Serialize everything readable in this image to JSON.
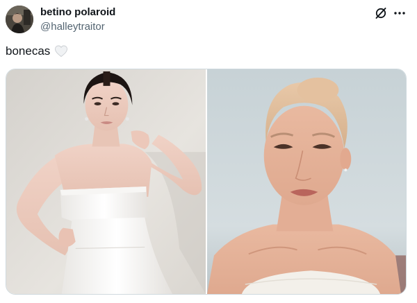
{
  "author": {
    "display_name": "betino polaroid",
    "handle": "@halleytraitor"
  },
  "header_icons": {
    "grok": "grok-icon",
    "more": "more-icon"
  },
  "tweet": {
    "text": "bonecas",
    "emoji": "white-heart-emoji"
  },
  "media": {
    "photo_count": 2
  },
  "colors": {
    "text_primary": "#0f1419",
    "text_secondary": "#536471",
    "border": "#cfd9de"
  }
}
